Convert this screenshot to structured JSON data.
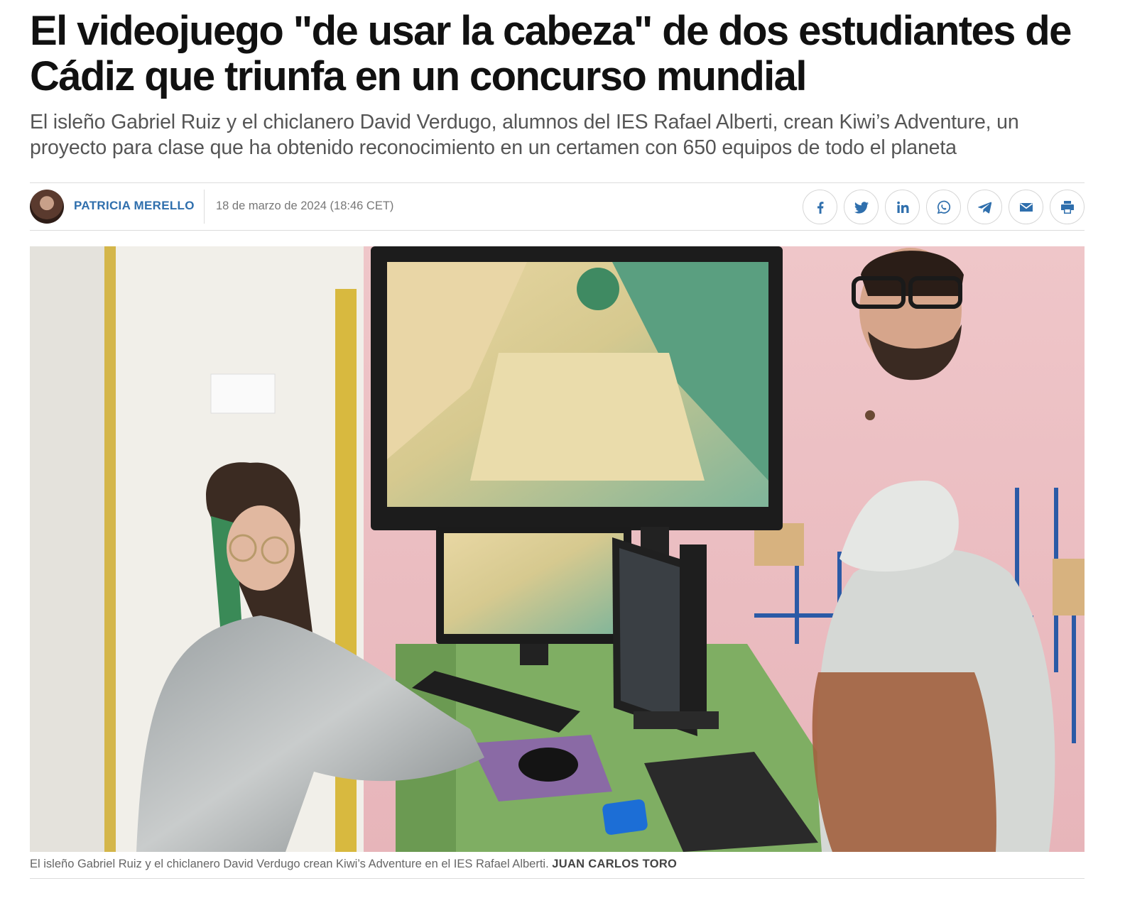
{
  "article": {
    "headline": "El videojuego \"de usar la cabeza\" de dos estudiantes de Cádiz que triunfa en un concurso mundial",
    "subtitle": "El isleño Gabriel Ruiz y el chiclanero David Verdugo, alumnos del IES Rafael Alberti, crean Kiwi’s Adventure, un proyecto para clase que ha obtenido reconocimiento en un certamen con 650 equipos de todo el planeta",
    "author": "PATRICIA MERELLO",
    "date": "18 de marzo de 2024 (18:46 CET)",
    "photo_caption": "El isleño Gabriel Ruiz y el chiclanero David Verdugo crean Kiwi’s Adventure en el IES Rafael Alberti.",
    "photo_credit": "JUAN CARLOS TORO"
  },
  "share_buttons": [
    {
      "icon": "facebook-icon"
    },
    {
      "icon": "twitter-icon"
    },
    {
      "icon": "linkedin-icon"
    },
    {
      "icon": "whatsapp-icon"
    },
    {
      "icon": "telegram-icon"
    },
    {
      "icon": "email-icon"
    },
    {
      "icon": "print-icon"
    }
  ],
  "colors": {
    "author_link": "#2f6fad",
    "share_icon": "#2f6fad",
    "divider": "#dcdcdc"
  }
}
